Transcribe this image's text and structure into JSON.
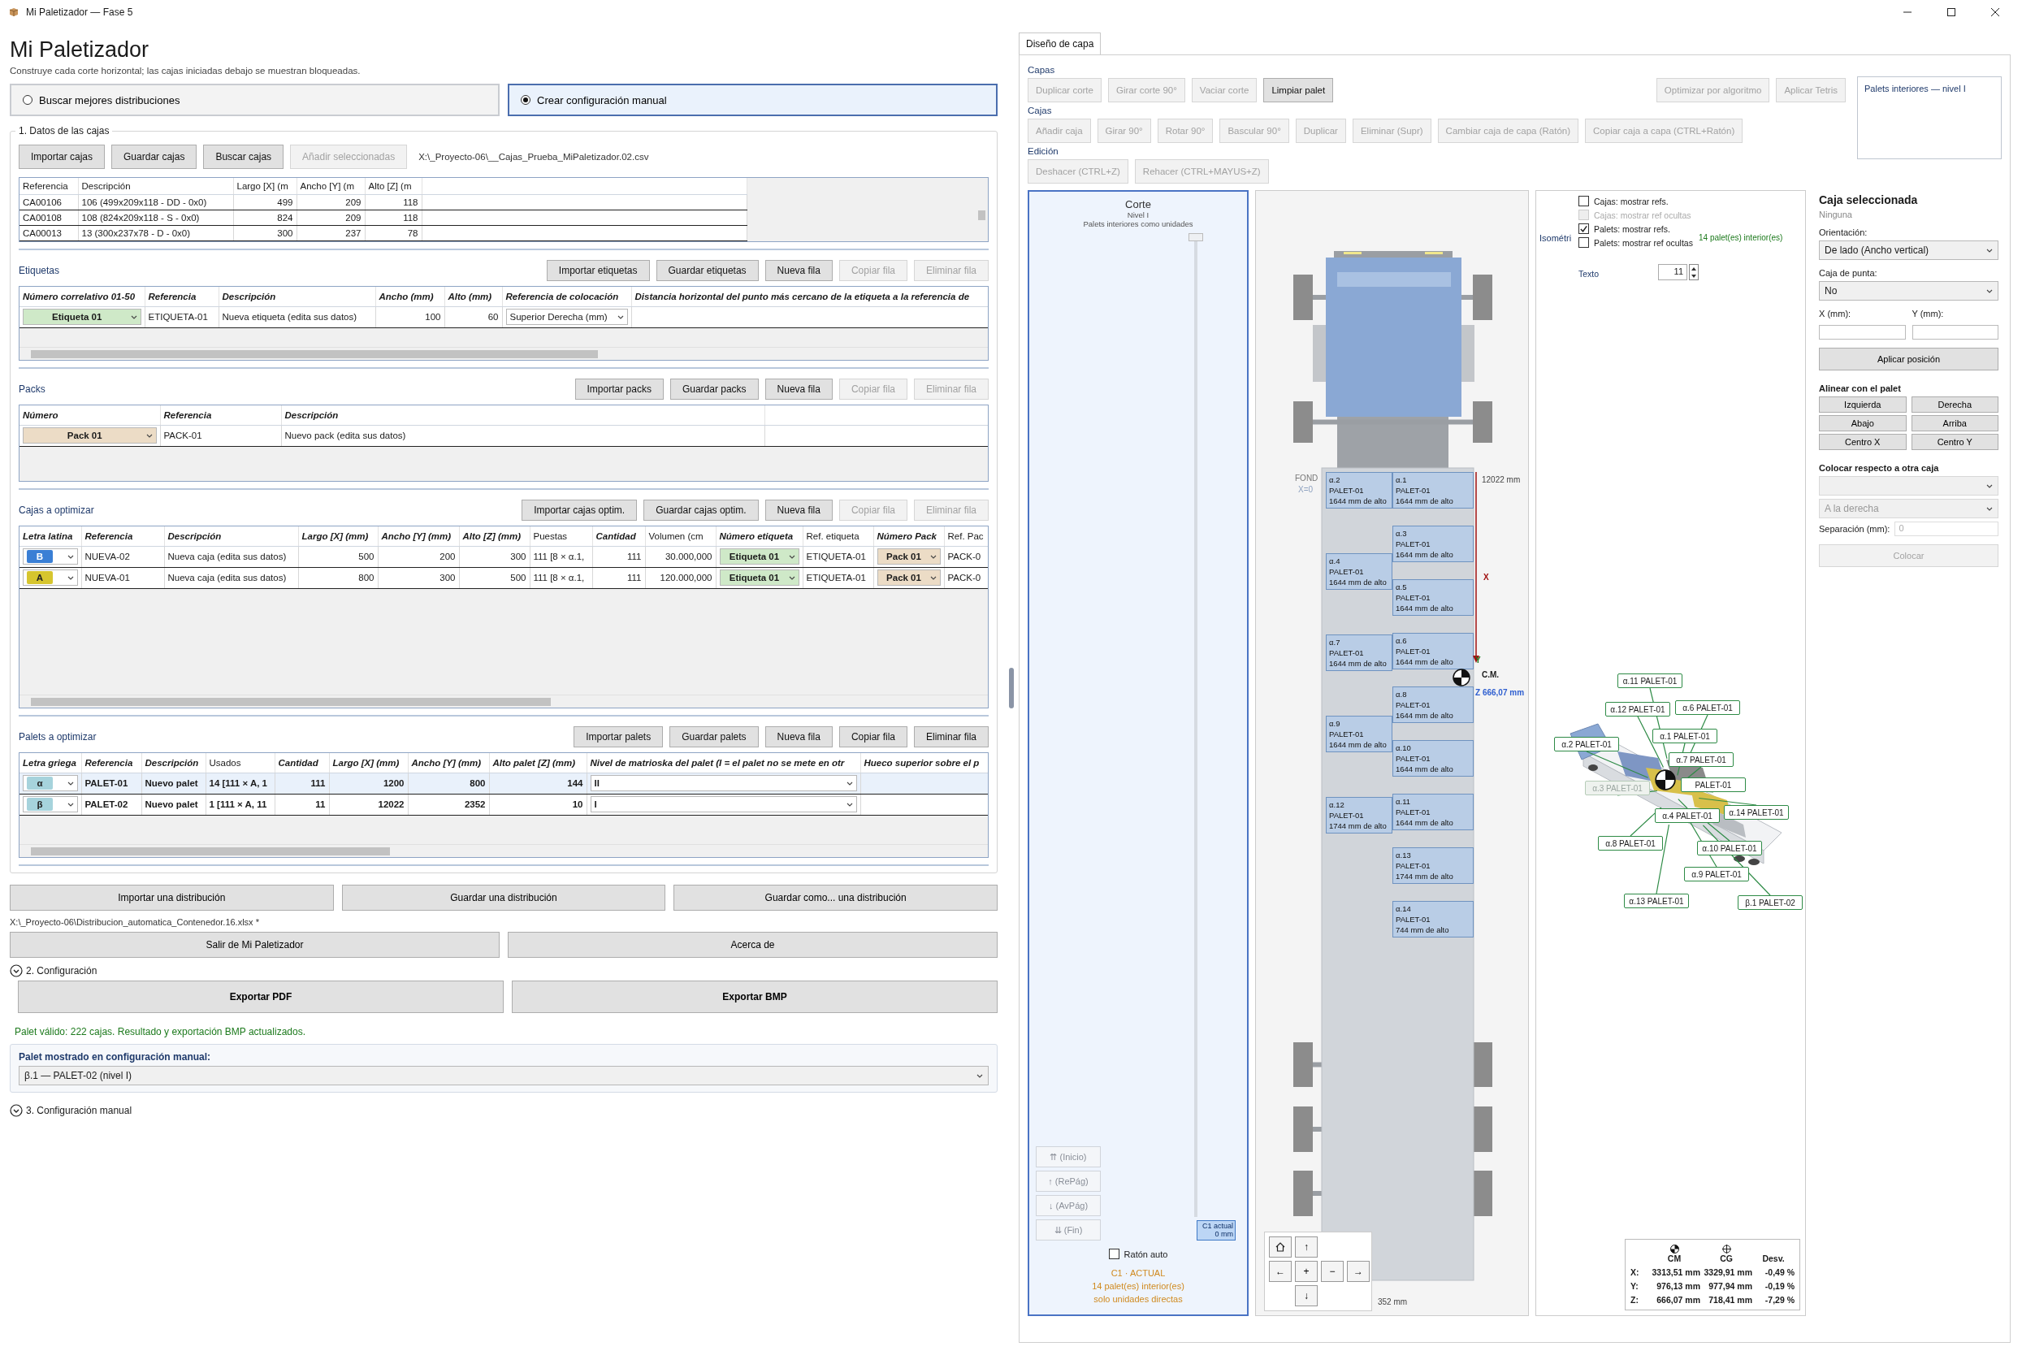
{
  "window": {
    "title": "Mi Paletizador — Fase 5"
  },
  "header": {
    "title": "Mi Paletizador",
    "subtitle": "Construye cada corte horizontal; las cajas iniciadas debajo se muestran bloqueadas."
  },
  "modes": [
    {
      "label": "Buscar mejores distribuciones",
      "selected": false
    },
    {
      "label": "Crear configuración manual",
      "selected": true
    }
  ],
  "box_data": {
    "title": "1. Datos de las cajas",
    "buttons": [
      {
        "label": "Importar cajas",
        "disabled": false
      },
      {
        "label": "Guardar cajas",
        "disabled": false
      },
      {
        "label": "Buscar cajas",
        "disabled": false
      },
      {
        "label": "Añadir seleccionadas",
        "disabled": true
      }
    ],
    "file": "X:\\_Proyecto-06\\__Cajas_Prueba_MiPaletizador.02.csv",
    "table": {
      "columns": [
        {
          "label": "Referencia",
          "kind": "text",
          "bold": false
        },
        {
          "label": "Descripción",
          "kind": "text",
          "bold": false
        },
        {
          "label": "Largo [X] (m",
          "kind": "number",
          "bold": false
        },
        {
          "label": "Ancho [Y] (m",
          "kind": "number",
          "bold": false
        },
        {
          "label": "Alto [Z] (m",
          "kind": "number",
          "bold": false
        }
      ],
      "rows": [
        {
          "cells": [
            "CA00106",
            "106 (499x209x118 - DD - 0x0)",
            "499",
            "209",
            "118"
          ]
        },
        {
          "cells": [
            "CA00108",
            "108 (824x209x118 - S - 0x0)",
            "824",
            "209",
            "118"
          ]
        },
        {
          "cells": [
            "CA00013",
            "13 (300x237x78 - D - 0x0)",
            "300",
            "237",
            "78"
          ]
        }
      ]
    }
  },
  "sections": [
    {
      "title": "Etiquetas",
      "buttons": [
        {
          "label": "Importar etiquetas",
          "disabled": false
        },
        {
          "label": "Guardar etiquetas",
          "disabled": false
        },
        {
          "label": "Nueva fila",
          "disabled": false
        },
        {
          "label": "Copiar fila",
          "disabled": true
        },
        {
          "label": "Eliminar fila",
          "disabled": true
        }
      ],
      "table": {
        "columns": [
          {
            "label": "Número correlativo 01-50",
            "kind": "combo",
            "bold": true
          },
          {
            "label": "Referencia",
            "kind": "text",
            "bold": true
          },
          {
            "label": "Descripción",
            "kind": "text",
            "bold": true
          },
          {
            "label": "Ancho (mm)",
            "kind": "number",
            "bold": true
          },
          {
            "label": "Alto (mm)",
            "kind": "number",
            "bold": true
          },
          {
            "label": "Referencia de colocación",
            "kind": "combo",
            "bold": true
          },
          {
            "label": "Distancia horizontal del punto más cercano de la etiqueta a la referencia de",
            "kind": "text",
            "bold": true
          }
        ],
        "rows": [
          {
            "cells": [
              {
                "text": "Etiqueta 01",
                "color": "#cfe9c8"
              },
              "ETIQUETA-01",
              "Nueva etiqueta (edita sus datos)",
              "100",
              "60",
              {
                "text": "Superior Derecha (mm)"
              }
            ]
          }
        ]
      }
    },
    {
      "title": "Packs",
      "buttons": [
        {
          "label": "Importar packs",
          "disabled": false
        },
        {
          "label": "Guardar packs",
          "disabled": false
        },
        {
          "label": "Nueva fila",
          "disabled": false
        },
        {
          "label": "Copiar fila",
          "disabled": true
        },
        {
          "label": "Eliminar fila",
          "disabled": true
        }
      ],
      "table": {
        "columns": [
          {
            "label": "Número",
            "kind": "combo",
            "bold": true
          },
          {
            "label": "Referencia",
            "kind": "text",
            "bold": true
          },
          {
            "label": "Descripción",
            "kind": "text",
            "bold": true
          }
        ],
        "rows": [
          {
            "cells": [
              {
                "text": "Pack 01",
                "color": "#ecdcc6"
              },
              "PACK-01",
              "Nuevo pack (edita sus datos)"
            ]
          }
        ]
      }
    },
    {
      "title": "Cajas a optimizar",
      "buttons": [
        {
          "label": "Importar cajas optim.",
          "disabled": false
        },
        {
          "label": "Guardar cajas optim.",
          "disabled": false
        },
        {
          "label": "Nueva fila",
          "disabled": false
        },
        {
          "label": "Copiar fila",
          "disabled": true
        },
        {
          "label": "Eliminar fila",
          "disabled": true
        }
      ],
      "table": {
        "columns": [
          {
            "label": "Letra latina",
            "kind": "letter",
            "bold": true
          },
          {
            "label": "Referencia",
            "kind": "text",
            "bold": true
          },
          {
            "label": "Descripción",
            "kind": "text",
            "bold": true
          },
          {
            "label": "Largo [X] (mm)",
            "kind": "number",
            "bold": true
          },
          {
            "label": "Ancho [Y] (mm)",
            "kind": "number",
            "bold": true
          },
          {
            "label": "Alto [Z] (mm)",
            "kind": "number",
            "bold": true
          },
          {
            "label": "Puestas",
            "kind": "text",
            "bold": false
          },
          {
            "label": "Cantidad",
            "kind": "number",
            "bold": true
          },
          {
            "label": "Volumen (cm",
            "kind": "number",
            "bold": false
          },
          {
            "label": "Número etiqueta",
            "kind": "combo",
            "bold": true
          },
          {
            "label": "Ref. etiqueta",
            "kind": "text",
            "bold": false
          },
          {
            "label": "Número Pack",
            "kind": "combo",
            "bold": true
          },
          {
            "label": "Ref. Pac",
            "kind": "text",
            "bold": false
          }
        ],
        "rows": [
          {
            "cells": [
              {
                "text": "B",
                "color": "#3a7fd5"
              },
              "NUEVA-02",
              "Nueva caja (edita sus datos)",
              "500",
              "200",
              "300",
              "111 [8 × α.1,",
              "111",
              "30.000,000",
              {
                "text": "Etiqueta 01",
                "color": "#cfe9c8"
              },
              "ETIQUETA-01",
              {
                "text": "Pack 01",
                "color": "#ecdcc6"
              },
              "PACK-0"
            ]
          },
          {
            "cells": [
              {
                "text": "A",
                "color": "#d6c52e"
              },
              "NUEVA-01",
              "Nueva caja (edita sus datos)",
              "800",
              "300",
              "500",
              "111 [8 × α.1,",
              "111",
              "120.000,000",
              {
                "text": "Etiqueta 01",
                "color": "#cfe9c8"
              },
              "ETIQUETA-01",
              {
                "text": "Pack 01",
                "color": "#ecdcc6"
              },
              "PACK-0"
            ]
          }
        ]
      }
    },
    {
      "title": "Palets a optimizar",
      "buttons": [
        {
          "label": "Importar palets",
          "disabled": false
        },
        {
          "label": "Guardar palets",
          "disabled": false
        },
        {
          "label": "Nueva fila",
          "disabled": false
        },
        {
          "label": "Copiar fila",
          "disabled": false
        },
        {
          "label": "Eliminar fila",
          "disabled": false
        }
      ],
      "table": {
        "columns": [
          {
            "label": "Letra griega",
            "kind": "letter",
            "bold": true
          },
          {
            "label": "Referencia",
            "kind": "text",
            "bold": true
          },
          {
            "label": "Descripción",
            "kind": "text",
            "bold": true
          },
          {
            "label": "Usados",
            "kind": "text",
            "bold": false
          },
          {
            "label": "Cantidad",
            "kind": "number",
            "bold": true
          },
          {
            "label": "Largo [X] (mm)",
            "kind": "number",
            "bold": true
          },
          {
            "label": "Ancho [Y] (mm)",
            "kind": "number",
            "bold": true
          },
          {
            "label": "Alto palet [Z] (mm)",
            "kind": "number",
            "bold": true
          },
          {
            "label": "Nivel de matrioska del palet (I = el palet no se mete en otr",
            "kind": "combo",
            "bold": true
          },
          {
            "label": "Hueco superior sobre el p",
            "kind": "text",
            "bold": true
          }
        ],
        "rows": [
          {
            "selected": true,
            "cells": [
              {
                "text": "α",
                "color": "#a6d3dc"
              },
              "PALET-01",
              "Nuevo palet",
              "14 [111 × A, 1",
              "111",
              "1200",
              "800",
              "144",
              {
                "text": "II"
              }
            ]
          },
          {
            "selected": false,
            "cells": [
              {
                "text": "β",
                "color": "#a6d3dc"
              },
              "PALET-02",
              "Nuevo palet",
              "1 [111 × A, 11",
              "11",
              "12022",
              "2352",
              "10",
              {
                "text": "I"
              }
            ]
          }
        ]
      }
    }
  ],
  "distribution": {
    "buttons": [
      "Importar una distribución",
      "Guardar una distribución",
      "Guardar como... una distribución"
    ],
    "file": "X:\\_Proyecto-06\\Distribucion_automatica_Contenedor.16.xlsx *"
  },
  "app_buttons": [
    "Salir de Mi Paletizador",
    "Acerca de"
  ],
  "configuration": {
    "title": "2. Configuración",
    "buttons": [
      "Exportar PDF",
      "Exportar BMP"
    ],
    "status": "Palet válido: 222 cajas. Resultado y exportación BMP actualizados.",
    "shown_pallet": {
      "label": "Palet mostrado en configuración manual:",
      "value": "β.1 — PALET-02 (nivel I)"
    }
  },
  "manual": {
    "title": "3. Configuración manual"
  },
  "layer_design": {
    "tab": {
      "label": "Diseño de capa",
      "selected": true
    },
    "groups": [
      {
        "title": "Capas",
        "buttons": [
          {
            "label": "Duplicar corte",
            "disabled": true
          },
          {
            "label": "Girar corte 90°",
            "disabled": true
          },
          {
            "label": "Vaciar corte",
            "disabled": true
          },
          {
            "label": "Limpiar palet",
            "disabled": false
          }
        ]
      },
      {
        "title": "Cajas",
        "buttons": [
          {
            "label": "Añadir caja",
            "disabled": true
          },
          {
            "label": "Girar 90°",
            "disabled": true
          },
          {
            "label": "Rotar 90°",
            "disabled": true
          },
          {
            "label": "Bascular 90°",
            "disabled": true
          },
          {
            "label": "Duplicar",
            "disabled": true
          },
          {
            "label": "Eliminar (Supr)",
            "disabled": true
          },
          {
            "label": "Cambiar caja de capa (Ratón)",
            "disabled": true
          },
          {
            "label": "Copiar caja a capa (CTRL+Ratón)",
            "disabled": true
          }
        ]
      },
      {
        "title": "Edición",
        "buttons": [
          {
            "label": "Deshacer (CTRL+Z)",
            "disabled": true
          },
          {
            "label": "Rehacer (CTRL+MAYUS+Z)",
            "disabled": true
          }
        ]
      }
    ],
    "algorithm_buttons": [
      {
        "label": "Optimizar por algoritmo",
        "disabled": true
      },
      {
        "label": "Aplicar Tetris",
        "disabled": true
      }
    ],
    "interior_pallets": {
      "title": "Palets interiores — nivel I"
    }
  },
  "cut": {
    "title": "Corte",
    "level": "Nivel I",
    "note": "Palets interiores como unidades",
    "slider": {
      "level": 1
    },
    "nav": [
      {
        "label": "⇈ (Inicio)",
        "disabled": true
      },
      {
        "label": "↑ (RePág)",
        "disabled": true
      },
      {
        "label": "↓ (AvPág)",
        "disabled": true
      },
      {
        "label": "⇊ (Fin)",
        "disabled": true
      }
    ],
    "marker": {
      "label": "C1 actual",
      "value": "0 mm"
    },
    "auto_mouse": {
      "label": "Ratón auto",
      "checked": false
    },
    "footer": [
      "C1 · ACTUAL",
      "14 palet(es) interior(es)",
      "solo unidades directas"
    ]
  },
  "top_view": {
    "origin": "FOND",
    "origin_x": "X=0",
    "length": "12022 mm",
    "x_axis": "X",
    "cm": {
      "label": "C.M.",
      "y_axis": "Y",
      "z": "Z 666,07 mm"
    },
    "width": "352 mm",
    "left_column": [
      {
        "ref": "α.2",
        "pallet": "PALET-01",
        "height": "1644 mm de alto"
      },
      {
        "ref": "α.4",
        "pallet": "PALET-01",
        "height": "1644 mm de alto"
      },
      {
        "ref": "α.7",
        "pallet": "PALET-01",
        "height": "1644 mm de alto"
      },
      {
        "ref": "α.9",
        "pallet": "PALET-01",
        "height": "1644 mm de alto"
      },
      {
        "ref": "α.12",
        "pallet": "PALET-01",
        "height": "1744 mm de alto"
      }
    ],
    "right_column": [
      {
        "ref": "α.1",
        "pallet": "PALET-01",
        "height": "1644 mm de alto"
      },
      {
        "ref": "α.3",
        "pallet": "PALET-01",
        "height": "1644 mm de alto"
      },
      {
        "ref": "α.5",
        "pallet": "PALET-01",
        "height": "1644 mm de alto"
      },
      {
        "ref": "α.6",
        "pallet": "PALET-01",
        "height": "1644 mm de alto"
      },
      {
        "ref": "α.8",
        "pallet": "PALET-01",
        "height": "1644 mm de alto"
      },
      {
        "ref": "α.10",
        "pallet": "PALET-01",
        "height": "1644 mm de alto"
      },
      {
        "ref": "α.11",
        "pallet": "PALET-01",
        "height": "1644 mm de alto"
      },
      {
        "ref": "α.13",
        "pallet": "PALET-01",
        "height": "1744 mm de alto"
      },
      {
        "ref": "α.14",
        "pallet": "PALET-01",
        "height": "744 mm de alto"
      }
    ],
    "nav_pad": [
      "↑",
      "←",
      "+",
      "−",
      "→",
      "↓"
    ]
  },
  "isometric": {
    "label": "Isométri",
    "options": [
      {
        "label": "Cajas: mostrar refs.",
        "checked": false,
        "disabled": false
      },
      {
        "label": "Cajas: mostrar ref ocultas",
        "checked": false,
        "disabled": true
      },
      {
        "label": "Palets: mostrar refs.",
        "checked": true,
        "disabled": false
      },
      {
        "label": "Palets: mostrar ref ocultas",
        "checked": false,
        "disabled": false
      }
    ],
    "count": "14 palet(es) interior(es)",
    "text_size": {
      "label": "Texto",
      "value": "11"
    },
    "callouts": [
      {
        "text": "α.11 PALET-01",
        "hidden": false
      },
      {
        "text": "α.12 PALET-01",
        "hidden": false
      },
      {
        "text": "α.6 PALET-01",
        "hidden": false
      },
      {
        "text": "α.2 PALET-01",
        "hidden": false
      },
      {
        "text": "α.1 PALET-01",
        "hidden": false
      },
      {
        "text": "α.7 PALET-01",
        "hidden": false
      },
      {
        "text": "α.3 PALET-01",
        "hidden": true
      },
      {
        "text": "PALET-01",
        "hidden": false
      },
      {
        "text": "α.4 PALET-01",
        "hidden": false
      },
      {
        "text": "α.14 PALET-01",
        "hidden": false
      },
      {
        "text": "α.8 PALET-01",
        "hidden": false
      },
      {
        "text": "α.10 PALET-01",
        "hidden": false
      },
      {
        "text": "α.9 PALET-01",
        "hidden": false
      },
      {
        "text": "α.13 PALET-01",
        "hidden": false
      },
      {
        "text": "β.1 PALET-02",
        "hidden": false
      }
    ],
    "stats": {
      "columns": [
        "CM",
        "CG",
        "Desv."
      ],
      "rows": [
        {
          "axis": "X:",
          "values": [
            "3313,51 mm",
            "3329,91 mm",
            "-0,49 %"
          ]
        },
        {
          "axis": "Y:",
          "values": [
            "976,13 mm",
            "977,94 mm",
            "-0,19 %"
          ]
        },
        {
          "axis": "Z:",
          "values": [
            "666,07 mm",
            "718,41 mm",
            "-7,29 %"
          ]
        }
      ]
    }
  },
  "selection": {
    "title": "Caja seleccionada",
    "value": "Ninguna",
    "orientation": {
      "label": "Orientación:",
      "value": "De lado (Ancho vertical)"
    },
    "tip": {
      "label": "Caja de punta:",
      "value": "No"
    },
    "x_label": "X (mm):",
    "y_label": "Y (mm):",
    "apply": "Aplicar posición",
    "align": {
      "title": "Alinear con el palet",
      "buttons": [
        "Izquierda",
        "Derecha",
        "Abajo",
        "Arriba",
        "Centro X",
        "Centro Y"
      ]
    },
    "relative": {
      "title": "Colocar respecto a otra caja",
      "side": "A la derecha",
      "separation_label": "Separación (mm):",
      "separation": "0",
      "button": "Colocar",
      "disabled": true
    }
  }
}
